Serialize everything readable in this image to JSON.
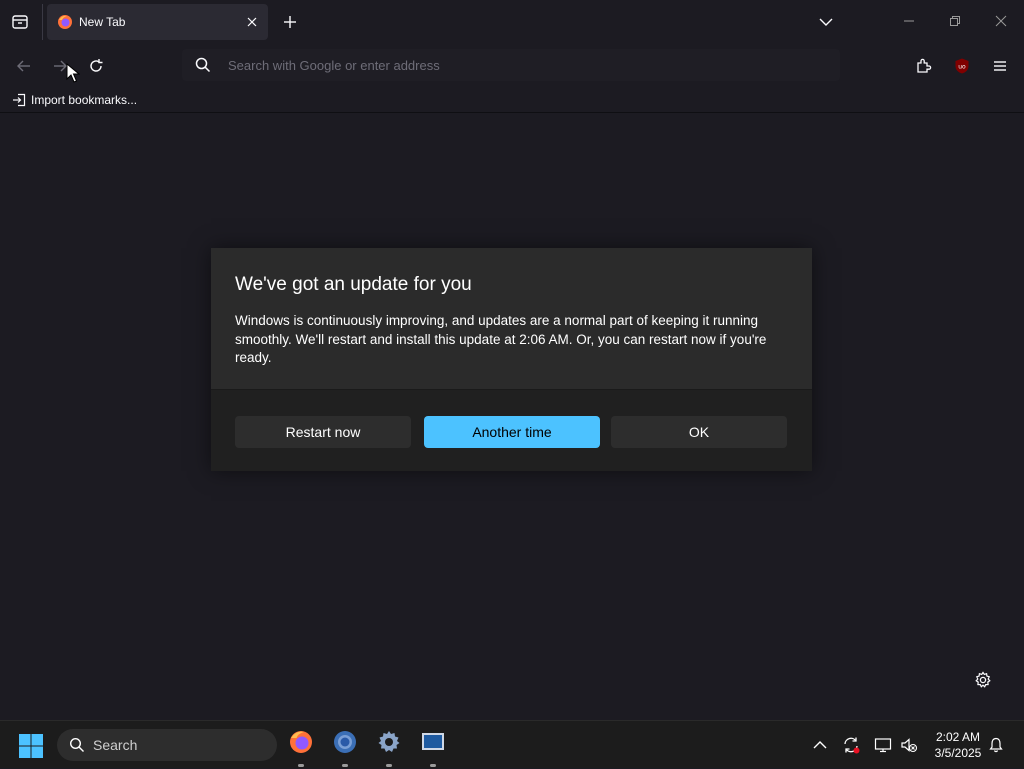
{
  "browser": {
    "tab": {
      "title": "New Tab"
    },
    "urlbar": {
      "placeholder": "Search with Google or enter address"
    },
    "bookmarks": {
      "import_label": "Import bookmarks..."
    },
    "extension_badge": "uo"
  },
  "dialog": {
    "title": "We've got an update for you",
    "body": "Windows is continuously improving, and updates are a normal part of keeping it running smoothly. We'll restart and install this update at 2:06 AM. Or, you can restart now if you're ready.",
    "buttons": {
      "restart_now": "Restart now",
      "another_time": "Another time",
      "ok": "OK"
    }
  },
  "taskbar": {
    "search_label": "Search",
    "clock": {
      "time": "2:02 AM",
      "date": "3/5/2025"
    },
    "apps": [
      "firefox-icon",
      "chrome-icon",
      "settings-icon",
      "virtualbox-icon"
    ]
  },
  "colors": {
    "browser_bg": "#1c1b22",
    "dialog_bg": "#2b2b2b",
    "accent": "#4cc2ff"
  }
}
